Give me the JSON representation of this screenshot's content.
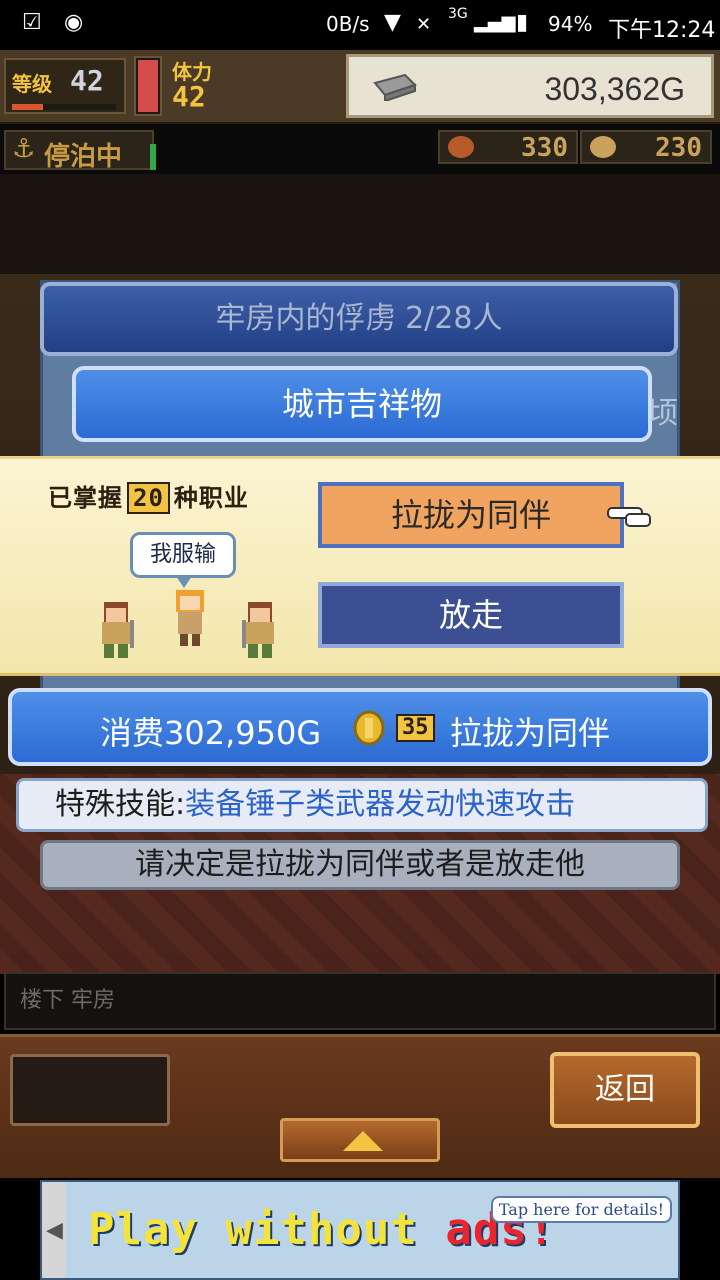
{
  "status_bar": {
    "net_speed": "0B/s",
    "network": "3G",
    "battery": "94%",
    "time": "下午12:24"
  },
  "hud": {
    "level_label": "等级",
    "level_value": "42",
    "stamina_label": "体力",
    "stamina_value": "42",
    "gold": "303,362G",
    "anchor_status": "停泊中",
    "food": "330",
    "coins": "230"
  },
  "panel": {
    "title": "牢房内的俘虏  2/28人",
    "subtitle": "城市吉祥物",
    "side_char": "顷"
  },
  "dialog": {
    "mastery_prefix": "已掌握",
    "mastery_num": "20",
    "mastery_suffix": "种职业",
    "speech": "我服输",
    "recruit_label": "拉拢为同伴",
    "release_label": "放走"
  },
  "cost": {
    "prefix": "消费302,950G",
    "coin_amount": "35",
    "suffix": "拉拢为同伴"
  },
  "skill": {
    "label": "特殊技能:",
    "value": "装备锤子类武器发动快速攻击"
  },
  "prompt": "请决定是拉拢为同伴或者是放走他",
  "location": "楼下 牢房",
  "nav": {
    "back_label": "返回"
  },
  "ad": {
    "text_a": "Play without ",
    "text_b": "ads!",
    "tap": "Tap here for details!"
  }
}
